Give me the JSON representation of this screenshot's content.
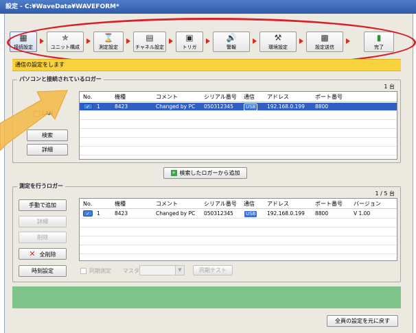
{
  "window": {
    "title": "設定 - C:¥WaveData¥WAVEFORM*"
  },
  "toolbar": {
    "steps": [
      {
        "label": "接続設定",
        "icon": "connection-icon"
      },
      {
        "label": "ユニット構成",
        "icon": "unit-icon"
      },
      {
        "label": "測定設定",
        "icon": "hourglass-icon"
      },
      {
        "label": "チャネル設定",
        "icon": "channel-icon"
      },
      {
        "label": "トリガ",
        "icon": "trigger-icon"
      },
      {
        "label": "警報",
        "icon": "alarm-icon"
      },
      {
        "label": "環境設定",
        "icon": "tools-icon"
      },
      {
        "label": "設定送信",
        "icon": "send-icon"
      },
      {
        "label": "完了",
        "icon": "finish-icon"
      }
    ],
    "highlight_color": "#d6202a"
  },
  "instruction": "通信の設定をします",
  "search_group": {
    "title": "パソコンと接続されているロガー",
    "count": "1 台",
    "lan_label": "LAN",
    "search_button": "検索",
    "detail_button": "詳細",
    "columns": [
      "No.",
      "機種",
      "コメント",
      "シリアル番号",
      "通信",
      "アドレス",
      "ポート番号"
    ],
    "rows": [
      {
        "no": "1",
        "model": "8423",
        "comment": "Changed by PC",
        "serial": "050312345",
        "comm": "USB",
        "address": "192.168.0.199",
        "port": "8800"
      }
    ]
  },
  "add_button": "検索したロガーから追加",
  "measure_group": {
    "title": "測定を行うロガー",
    "count": "1 / 5 台",
    "manual_add": "手動で追加",
    "detail": "詳細",
    "delete": "削除",
    "delete_all": "全削除",
    "time_setting": "時刻設定",
    "sync_measure": "同期測定",
    "master_label": "マスタ",
    "sync_test": "同期テスト",
    "columns": [
      "No.",
      "機種",
      "コメント",
      "シリアル番号",
      "通信",
      "アドレス",
      "ポート番号",
      "バージョン"
    ],
    "rows": [
      {
        "no": "1",
        "model": "8423",
        "comment": "Changed by PC",
        "serial": "050312345",
        "comm": "USB",
        "address": "192.168.0.199",
        "port": "8800",
        "version": "V 1.00"
      }
    ]
  },
  "restore_button": "全頁の設定を元に戻す",
  "colors": {
    "instruction_bg": "#f7d23c",
    "selected_row": "#2f5fc4",
    "green_bar": "#7fc58a",
    "overlay_arrow": "#f3b94a"
  }
}
